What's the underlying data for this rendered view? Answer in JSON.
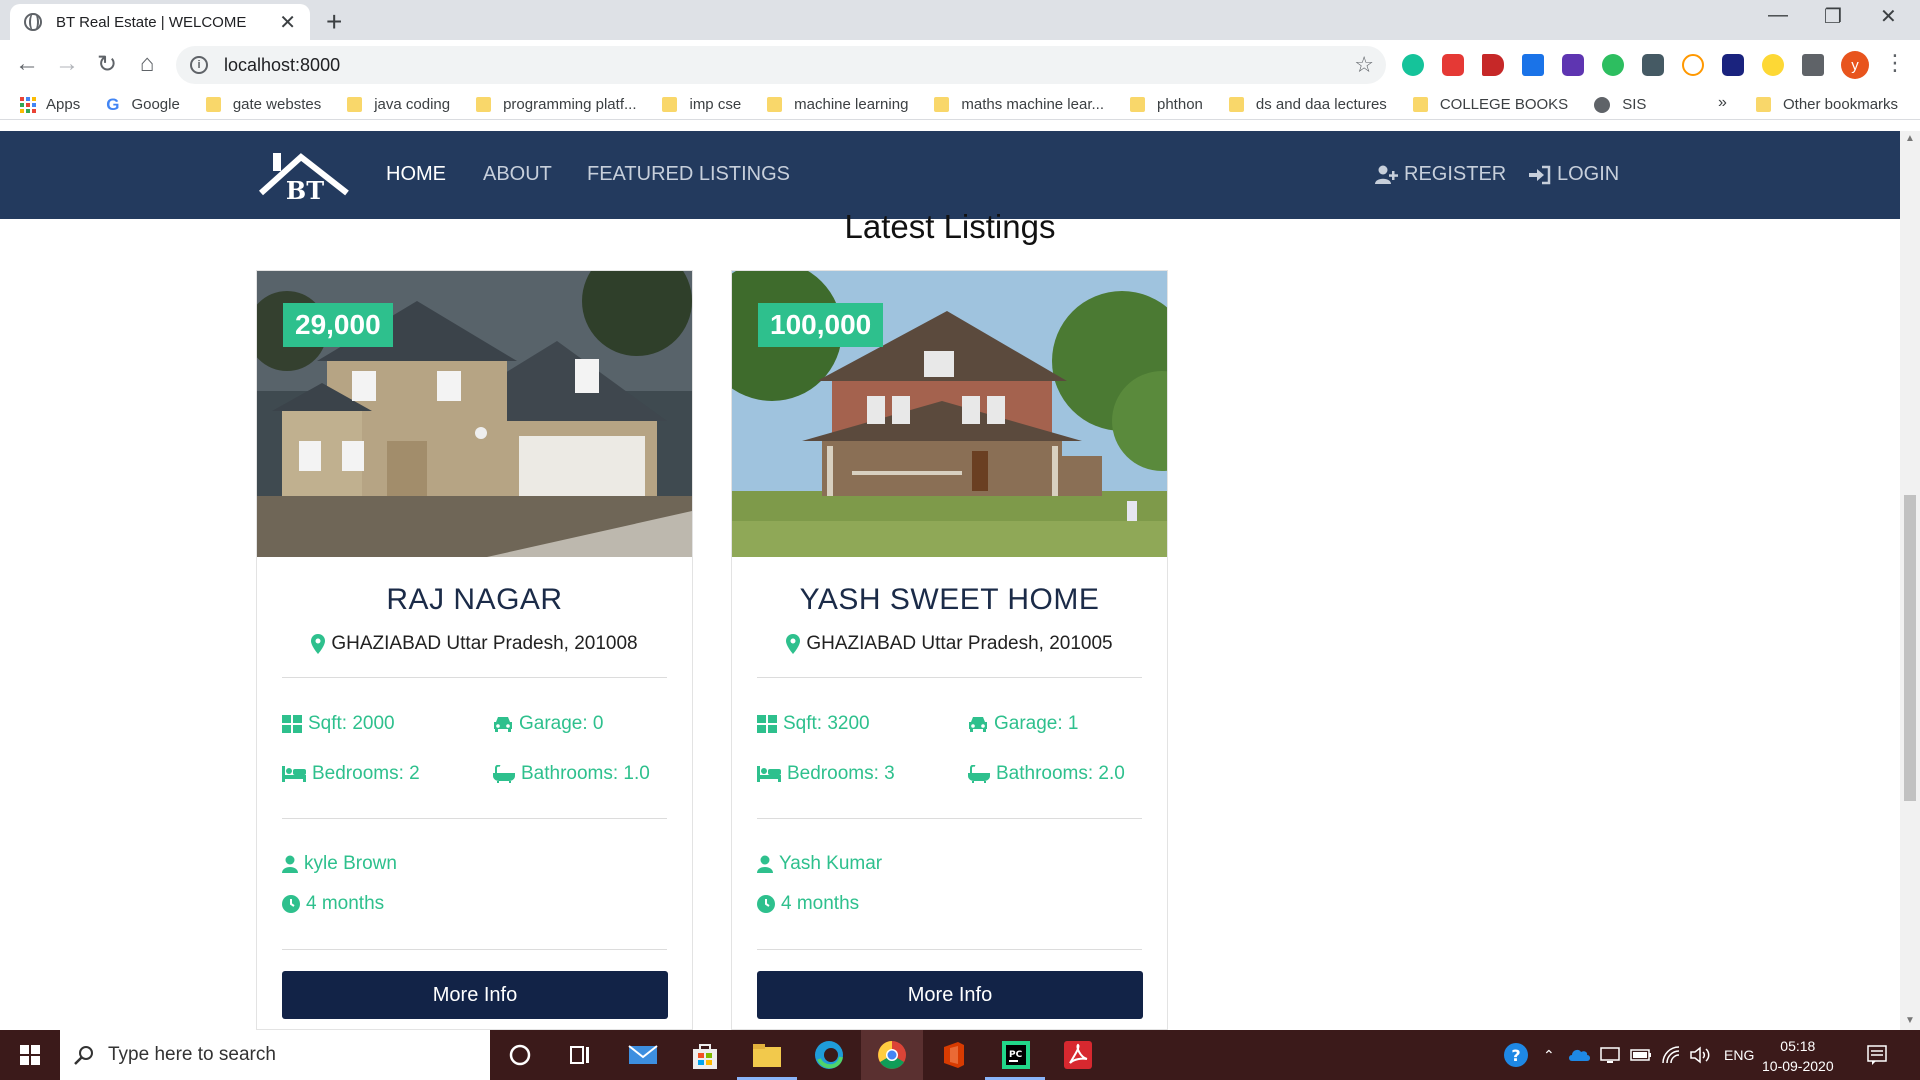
{
  "browser": {
    "tab_title": "BT Real Estate | WELCOME",
    "new_tab": "+",
    "url": "localhost:8000",
    "profile_initial": "y",
    "bookmarks": [
      "Apps",
      "Google",
      "gate webstes",
      "java coding",
      "programming platf...",
      "imp cse",
      "machine learning",
      "maths machine lear...",
      "phthon",
      "ds and daa lectures",
      "COLLEGE BOOKS",
      "SIS"
    ],
    "bookmarks_more": "»",
    "other_bookmarks": "Other bookmarks"
  },
  "nav": {
    "logo_text": "BT",
    "links": [
      "HOME",
      "ABOUT",
      "FEATURED LISTINGS"
    ],
    "register": "REGISTER",
    "login": "LOGIN"
  },
  "section_title": "Latest Listings",
  "listings": [
    {
      "price": "29,000",
      "title": "RAJ NAGAR",
      "address": "GHAZIABAD Uttar Pradesh, 201008",
      "sqft": "Sqft: 2000",
      "garage": "Garage: 0",
      "bedrooms": "Bedrooms: 2",
      "bathrooms": "Bathrooms: 1.0",
      "realtor": "kyle Brown",
      "listed": "4 months",
      "button": "More Info"
    },
    {
      "price": "100,000",
      "title": "YASH SWEET HOME",
      "address": "GHAZIABAD Uttar Pradesh, 201005",
      "sqft": "Sqft: 3200",
      "garage": "Garage: 1",
      "bedrooms": "Bedrooms: 3",
      "bathrooms": "Bathrooms: 2.0",
      "realtor": "Yash Kumar",
      "listed": "4 months",
      "button": "More Info"
    }
  ],
  "taskbar": {
    "search_placeholder": "Type here to search",
    "lang": "ENG",
    "time": "05:18",
    "date": "10-09-2020"
  },
  "colors": {
    "navbar": "#233a5e",
    "accent": "#2ec08d",
    "button": "#122347"
  }
}
